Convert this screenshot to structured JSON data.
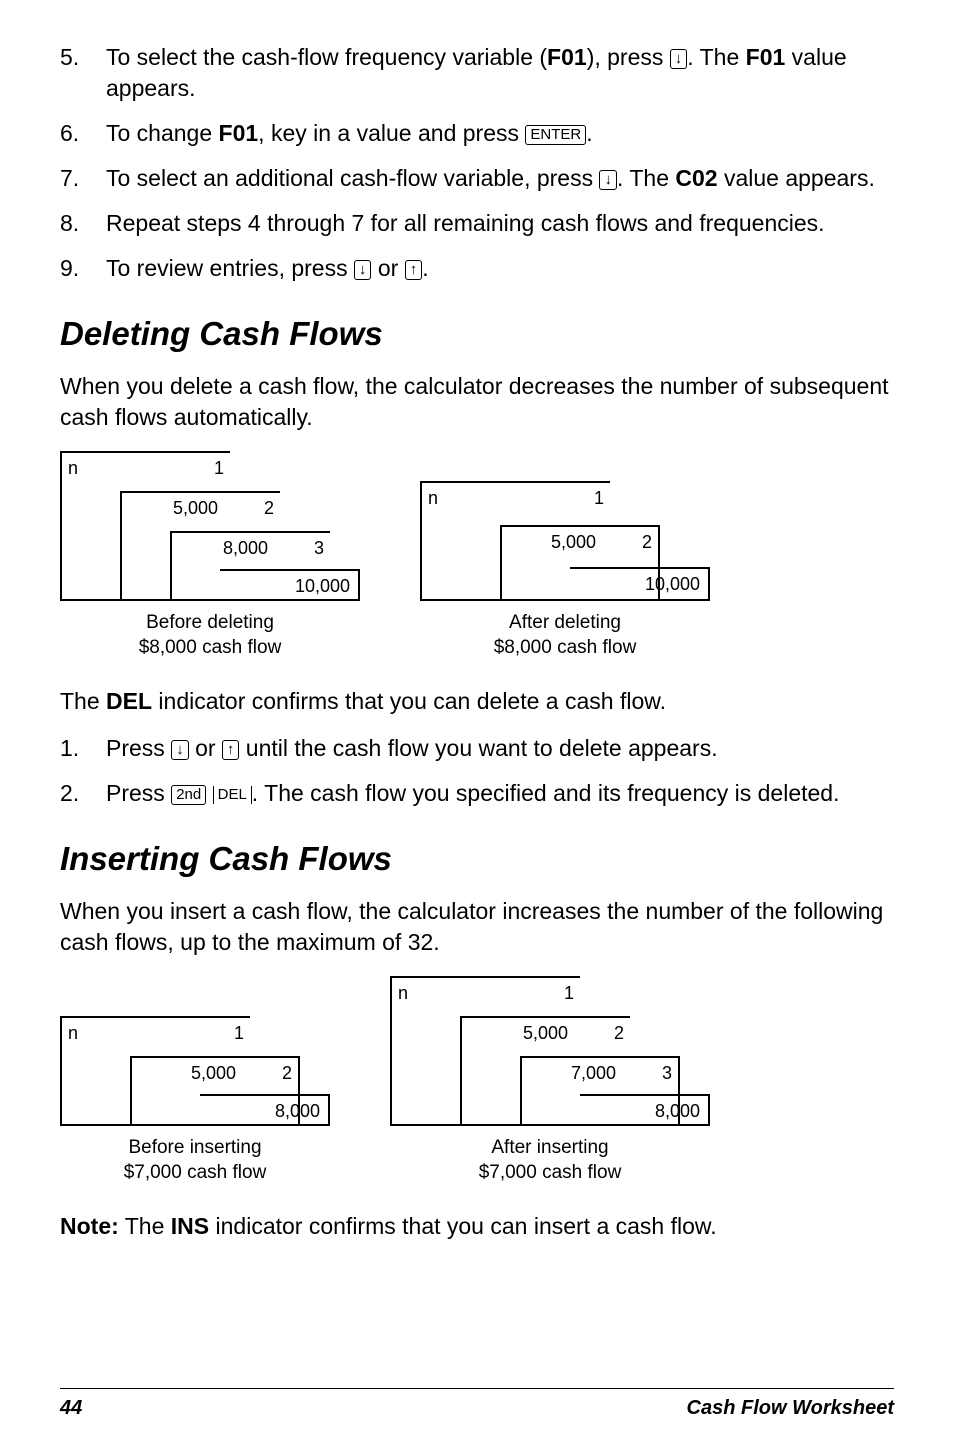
{
  "list1": {
    "i5": {
      "num": "5.",
      "pre": "To select the cash-flow frequency variable (",
      "bold1": "F01",
      "mid": "), press ",
      "key": "↓",
      "post": ". The ",
      "bold2": "F01",
      "end": " value appears."
    },
    "i6": {
      "num": "6.",
      "pre": "To change ",
      "bold": "F01",
      "mid": ", key in a value and press ",
      "key": "ENTER",
      "post": "."
    },
    "i7": {
      "num": "7.",
      "pre": "To select an additional cash-flow variable, press ",
      "key": "↓",
      "mid": ". The ",
      "bold": "C02",
      "post": " value appears."
    },
    "i8": {
      "num": "8.",
      "txt": "Repeat steps 4 through 7 for all remaining cash flows and frequencies."
    },
    "i9": {
      "num": "9.",
      "pre": "To review entries, press ",
      "key1": "↓",
      "or": " or ",
      "key2": "↑",
      "post": "."
    }
  },
  "sec_delete": {
    "title": "Deleting Cash Flows",
    "intro": "When you delete a cash flow, the calculator decreases the number of subsequent cash flows automatically.",
    "dia_before": {
      "n": "n",
      "r1": "1",
      "v1": "5,000",
      "r2": "2",
      "v2": "8,000",
      "r3": "3",
      "v3": "10,000",
      "cap1": "Before deleting",
      "cap2": "$8,000 cash flow"
    },
    "dia_after": {
      "n": "n",
      "r1": "1",
      "v1": "5,000",
      "r2": "2",
      "v2": "10,000",
      "cap1": "After deleting",
      "cap2": "$8,000 cash flow"
    },
    "p_del": {
      "pre": "The ",
      "bold": "DEL",
      "post": " indicator confirms that you can delete a cash flow."
    },
    "s1": {
      "num": "1.",
      "pre": "Press ",
      "key1": "↓",
      "or": " or ",
      "key2": "↑",
      "post": " until the cash flow you want to delete appears."
    },
    "s2": {
      "num": "2.",
      "pre": "Press ",
      "key1": "2nd",
      "key2": "DEL",
      "post": ". The cash flow you specified and its frequency is deleted."
    }
  },
  "sec_insert": {
    "title": "Inserting Cash Flows",
    "intro": "When you insert a cash flow, the calculator increases the number of the following cash flows, up to the maximum of 32.",
    "dia_before": {
      "n": "n",
      "r1": "1",
      "v1": "5,000",
      "r2": "2",
      "v2": "8,000",
      "cap1": "Before inserting",
      "cap2": "$7,000 cash flow"
    },
    "dia_after": {
      "n": "n",
      "r1": "1",
      "v1": "5,000",
      "r2": "2",
      "v2": "7,000",
      "r3": "3",
      "v3": "8,000",
      "cap1": "After inserting",
      "cap2": "$7,000 cash flow"
    },
    "note": {
      "label": "Note:",
      "pre": " The ",
      "bold": "INS",
      "post": " indicator confirms that you can insert a cash flow."
    }
  },
  "footer": {
    "page": "44",
    "title": "Cash Flow Worksheet"
  }
}
